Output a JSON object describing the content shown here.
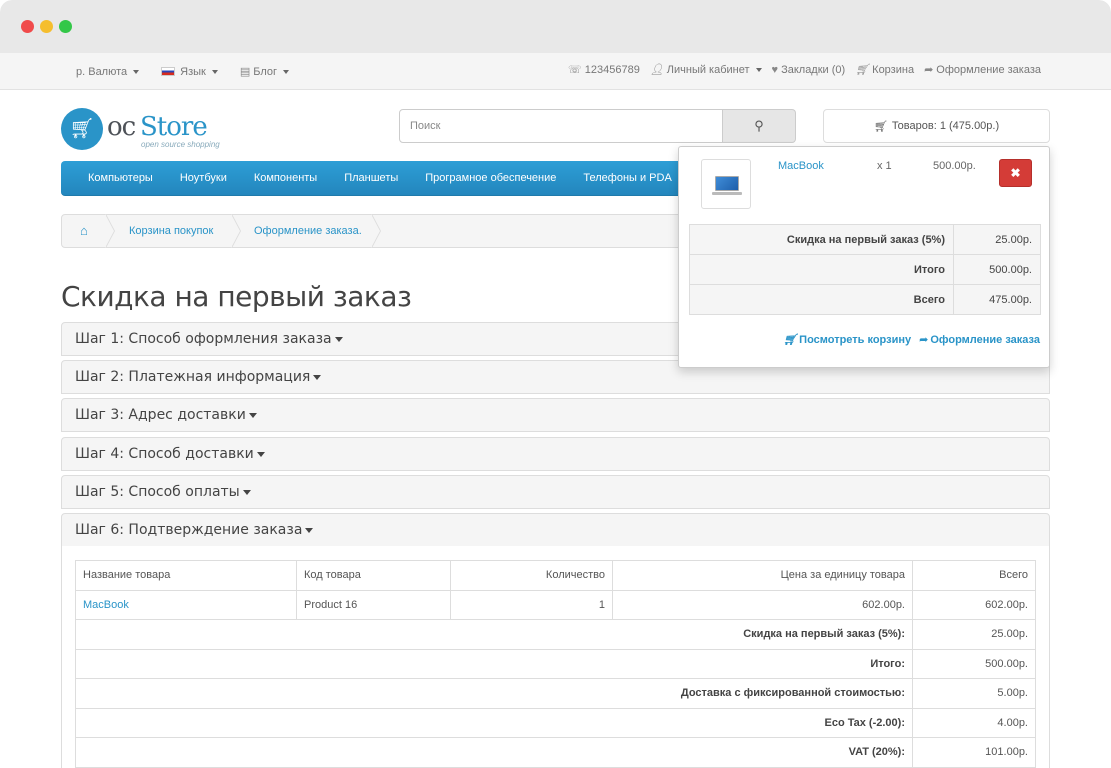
{
  "topbar": {
    "currency": "р. Валюта",
    "language": "Язык",
    "blog": "Блог",
    "phone": "123456789",
    "account": "Личный кабинет",
    "wishlist": "Закладки (0)",
    "cart": "Корзина",
    "checkout": "Оформление заказа"
  },
  "logo": {
    "oc": "oc",
    "store": "Store",
    "tagline": "open source shopping"
  },
  "search": {
    "placeholder": "Поиск"
  },
  "cart_button": {
    "label": "Товаров: 1 (475.00р.)"
  },
  "menu": [
    "Компьютеры",
    "Ноутбуки",
    "Компоненты",
    "Планшеты",
    "Програмное обеспечение",
    "Телефоны и PDA"
  ],
  "breadcrumb": [
    "Корзина покупок",
    "Оформление заказа."
  ],
  "page_title": "Скидка на первый заказ",
  "steps": [
    "Шаг 1: Способ оформления заказа",
    "Шаг 2: Платежная информация",
    "Шаг 3: Адрес доставки",
    "Шаг 4: Способ доставки",
    "Шаг 5: Способ оплаты",
    "Шаг 6: Подтверждение заказа"
  ],
  "order": {
    "headers": [
      "Название товара",
      "Код товара",
      "Количество",
      "Цена за единицу товара",
      "Всего"
    ],
    "row": {
      "name": "MacBook",
      "code": "Product 16",
      "qty": "1",
      "price": "602.00р.",
      "total": "602.00р."
    },
    "totals": [
      {
        "label": "Скидка на первый заказ (5%):",
        "value": "25.00р."
      },
      {
        "label": "Итого:",
        "value": "500.00р."
      },
      {
        "label": "Доставка с фиксированной стоимостью:",
        "value": "5.00р."
      },
      {
        "label": "Eco Tax (-2.00):",
        "value": "4.00р."
      },
      {
        "label": "VAT (20%):",
        "value": "101.00р."
      }
    ]
  },
  "cart_dropdown": {
    "product": {
      "name": "MacBook",
      "qty": "x 1",
      "price": "500.00р.",
      "remove": "✖"
    },
    "totals": [
      {
        "label": "Скидка на первый заказ (5%)",
        "value": "25.00р."
      },
      {
        "label": "Итого",
        "value": "500.00р."
      },
      {
        "label": "Всего",
        "value": "475.00р."
      }
    ],
    "view_cart": "Посмотреть корзину",
    "checkout": "Оформление заказа"
  },
  "colors": {
    "accent": "#2a94c8",
    "menu": "#2386bd",
    "danger": "#d43c37"
  }
}
